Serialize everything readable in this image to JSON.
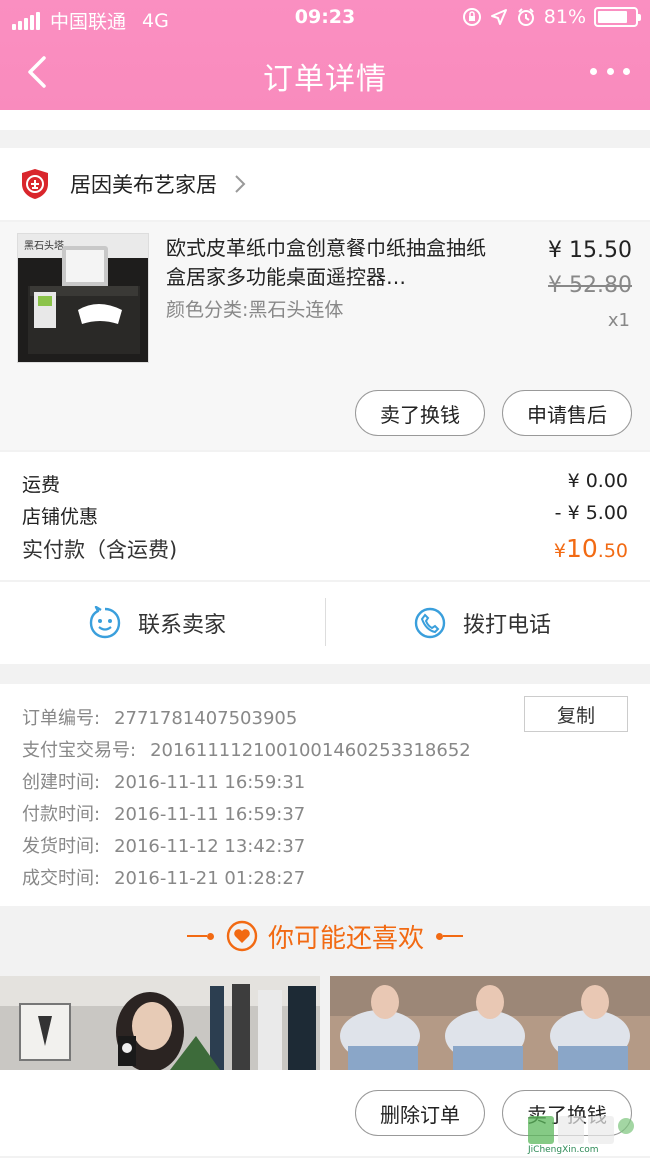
{
  "status_bar": {
    "carrier": "中国联通",
    "network": "4G",
    "time": "09:23",
    "battery": "81%",
    "battery_level": 0.81
  },
  "nav": {
    "title": "订单详情"
  },
  "shop": {
    "name": "居因美布艺家居"
  },
  "product": {
    "image_text": "黑石头塔",
    "title": "欧式皮革纸巾盒创意餐巾纸抽盒抽纸盒居家多功能桌面遥控器…",
    "sku": "颜色分类:黑石头连体",
    "price": "¥ 15.50",
    "original_price": "¥ 52.80",
    "quantity": "x1",
    "buttons": {
      "sell": "卖了换钱",
      "after_sale": "申请售后"
    }
  },
  "costs": {
    "shipping_label": "运费",
    "shipping_value": "¥ 0.00",
    "discount_label": "店铺优惠",
    "discount_value": "- ¥ 5.00",
    "paid_label": "实付款（含运费)",
    "paid_symbol": "¥",
    "paid_int": "10",
    "paid_dec": ".50"
  },
  "contact": {
    "seller": "联系卖家",
    "phone": "拨打电话"
  },
  "order_info": {
    "copy_button": "复制",
    "rows": [
      {
        "label": "订单编号:",
        "value": "2771781407503905"
      },
      {
        "label": "支付宝交易号:",
        "value": "2016111121001001460253318652"
      },
      {
        "label": "创建时间:",
        "value": "2016-11-11 16:59:31"
      },
      {
        "label": "付款时间:",
        "value": "2016-11-11 16:59:37"
      },
      {
        "label": "发货时间:",
        "value": "2016-11-12 13:42:37"
      },
      {
        "label": "成交时间:",
        "value": "2016-11-21 01:28:27"
      }
    ]
  },
  "recommend": {
    "title": "你可能还喜欢"
  },
  "bottom_bar": {
    "delete": "删除订单",
    "sell": "卖了换钱"
  },
  "watermark": {
    "brand": "JiChengXin.com"
  },
  "colors": {
    "header": "#f98bbd",
    "accent": "#f26a13",
    "icon_blue": "#3a9fdc",
    "shop_red": "#d9262c"
  }
}
